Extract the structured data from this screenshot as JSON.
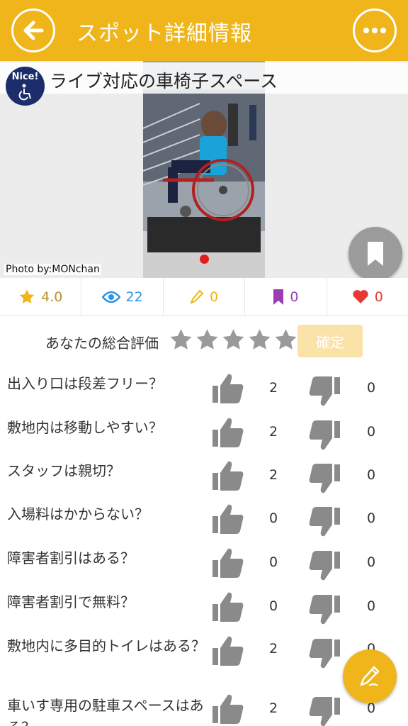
{
  "header": {
    "title": "スポット詳細情報",
    "back_icon": "arrow-left-icon",
    "more_icon": "more-horizontal-icon",
    "color": "#efb51b"
  },
  "spot": {
    "badge_text": "Nice!",
    "badge_icon": "wheelchair-icon",
    "title": "ライブ対応の車椅子スペース",
    "photo_credit": "Photo by:MONchan"
  },
  "stats": {
    "rating": "4.0",
    "views": "22",
    "edits": "0",
    "bookmarks": "0",
    "likes": "0"
  },
  "rating_prompt": {
    "label": "あなたの総合評価",
    "confirm_label": "確定"
  },
  "questions": [
    {
      "text": "出入り口は段差フリー？",
      "up": "2",
      "down": "0"
    },
    {
      "text": "敷地内は移動しやすい？",
      "up": "2",
      "down": "0"
    },
    {
      "text": "スタッフは親切？",
      "up": "2",
      "down": "0"
    },
    {
      "text": "入場料はかからない？",
      "up": "0",
      "down": "0"
    },
    {
      "text": "障害者割引はある？",
      "up": "0",
      "down": "0"
    },
    {
      "text": "障害者割引で無料？",
      "up": "0",
      "down": "0"
    },
    {
      "text": "敷地内に多目的トイレはある？",
      "up": "2",
      "down": "0"
    },
    {
      "text": "車いす専用の駐車スペースはある？",
      "up": "2",
      "down": "0"
    }
  ],
  "colors": {
    "star": "#efb51b",
    "views": "#2a96e6",
    "edits": "#efb51b",
    "bookmarks": "#9b3bb5",
    "likes": "#e53935",
    "thumb": "#8a8a8a"
  }
}
